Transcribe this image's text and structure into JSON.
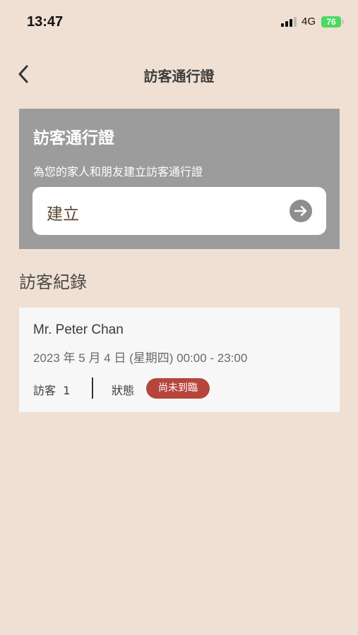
{
  "status_bar": {
    "time": "13:47",
    "network": "4G",
    "battery": "76"
  },
  "nav": {
    "title": "訪客通行證",
    "back_icon": "chevron-left-icon"
  },
  "pass_card": {
    "title": "訪客通行證",
    "subtitle": "為您的家人和朋友建立訪客通行證",
    "create_label": "建立",
    "create_icon": "arrow-right-circle-icon"
  },
  "records": {
    "title": "訪客紀錄",
    "items": [
      {
        "name": "Mr. Peter Chan",
        "datetime": "2023 年 5 月 4 日 (星期四) 00:00 - 23:00",
        "visitor_label": "訪客",
        "visitor_count": "1",
        "status_label": "狀態",
        "status": "尚未到臨"
      }
    ]
  },
  "colors": {
    "background": "#f0e0d3",
    "card": "#9c9c9c",
    "badge": "#b6463c",
    "battery": "#4cd964"
  }
}
